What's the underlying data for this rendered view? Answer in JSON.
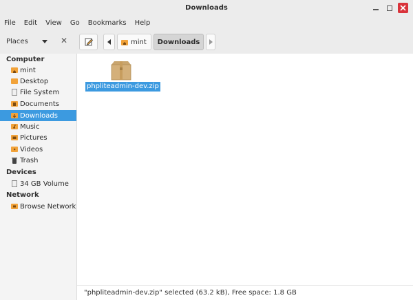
{
  "window": {
    "title": "Downloads"
  },
  "menubar": {
    "items": [
      "File",
      "Edit",
      "View",
      "Go",
      "Bookmarks",
      "Help"
    ]
  },
  "toolbar": {
    "places_label": "Places",
    "breadcrumbs": [
      "mint",
      "Downloads"
    ]
  },
  "sidebar": {
    "sections": [
      {
        "title": "Computer"
      },
      {
        "title": "Devices"
      },
      {
        "title": "Network"
      }
    ],
    "items": [
      {
        "label": "mint",
        "icon": "home-folder-icon"
      },
      {
        "label": "Desktop",
        "icon": "folder-icon"
      },
      {
        "label": "File System",
        "icon": "drive-icon"
      },
      {
        "label": "Documents",
        "icon": "documents-folder-icon"
      },
      {
        "label": "Downloads",
        "icon": "downloads-folder-icon",
        "active": true
      },
      {
        "label": "Music",
        "icon": "music-folder-icon"
      },
      {
        "label": "Pictures",
        "icon": "pictures-folder-icon"
      },
      {
        "label": "Videos",
        "icon": "videos-folder-icon"
      },
      {
        "label": "Trash",
        "icon": "trash-icon"
      },
      {
        "label": "34 GB Volume",
        "icon": "drive-icon"
      },
      {
        "label": "Browse Network",
        "icon": "network-folder-icon"
      }
    ]
  },
  "files": [
    {
      "name": "phpliteadmin-dev.zip",
      "icon": "archive-icon",
      "selected": true
    }
  ],
  "status": {
    "text": "\"phpliteadmin-dev.zip\" selected (63.2 kB), Free space: 1.8 GB"
  },
  "colors": {
    "accent": "#3c9ae0",
    "folder": "#f2a33a",
    "close": "#d9333b"
  }
}
